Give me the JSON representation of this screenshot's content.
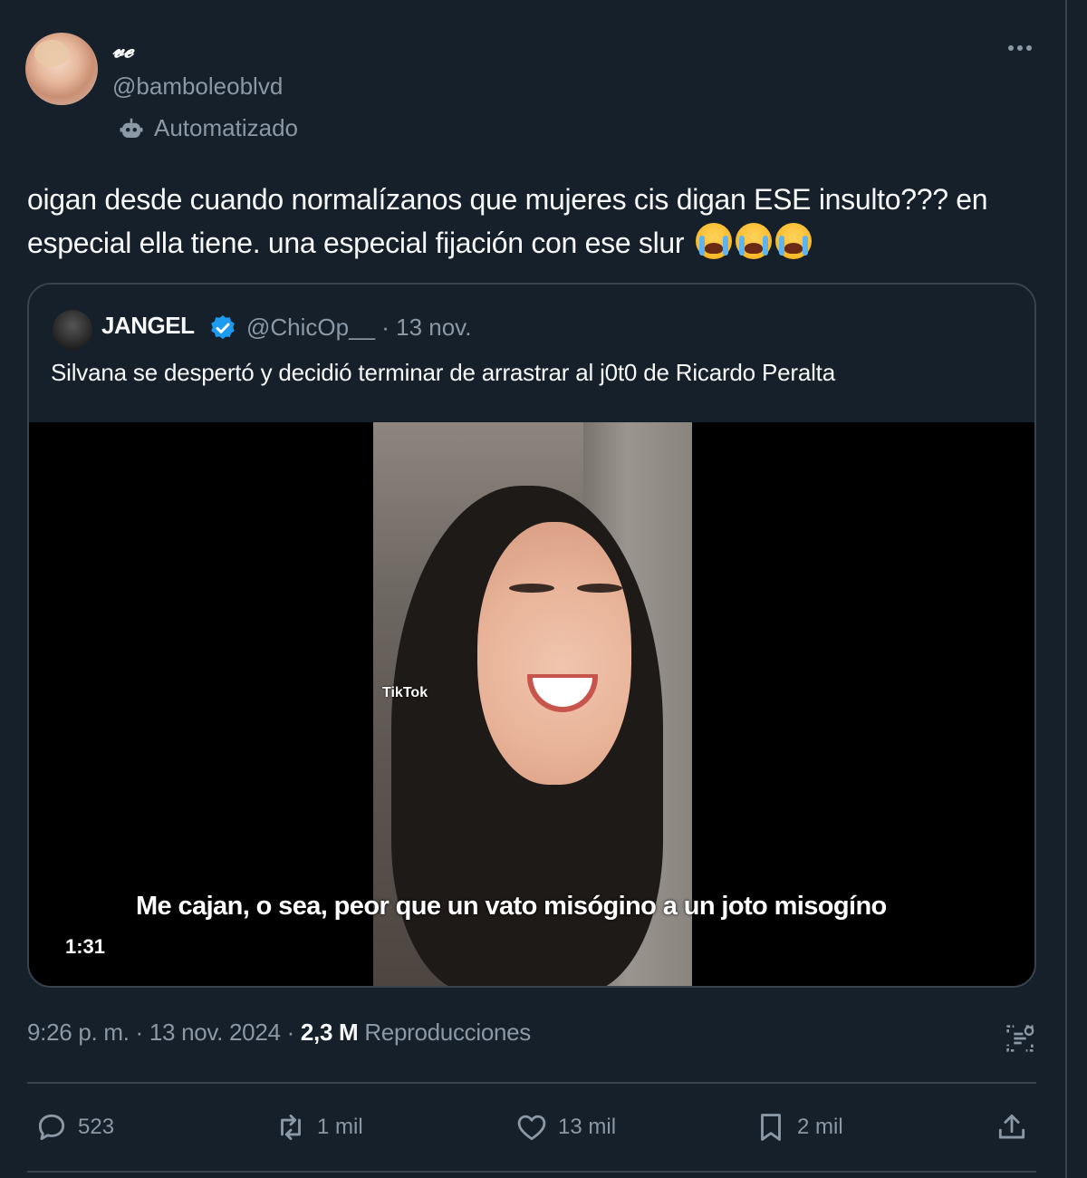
{
  "author": {
    "display_name": "𝓿𝓮",
    "handle": "@bamboleoblvd",
    "automated_label": "Automatizado"
  },
  "tweet": {
    "text": "oigan desde cuando normalízanos que mujeres cis digan ESE insulto??? en especial ella tiene. una especial fijación con ese slur",
    "emojis": [
      "loudly-crying-face",
      "loudly-crying-face",
      "loudly-crying-face"
    ]
  },
  "quoted": {
    "name": "JANGEL",
    "handle_date": "@ChicOp__ · 13 nov.",
    "text": "Silvana se despertó y decidió terminar de arrastrar al j0t0 de Ricardo Peralta",
    "video": {
      "watermark": "TikTok",
      "caption": "Me cajan, o sea, peor que un vato misógino a un joto misogíno",
      "duration": "1:31"
    }
  },
  "meta": {
    "timestamp": "9:26 p. m. · 13 nov. 2024 · ",
    "views_count": "2,3 M",
    "views_label": " Reproducciones"
  },
  "actions": {
    "replies": "523",
    "reposts": "1 mil",
    "likes": "13 mil",
    "bookmarks": "2 mil"
  },
  "colors": {
    "background": "#15202b",
    "border": "#38444d",
    "muted_text": "#8b98a5",
    "verified": "#1d9bf0"
  }
}
